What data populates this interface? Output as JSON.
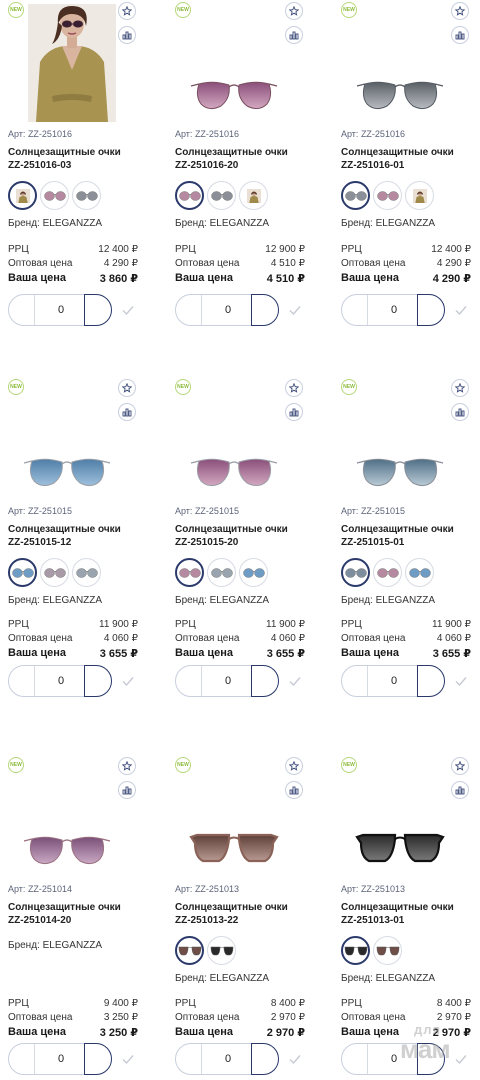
{
  "labels": {
    "new_badge": "NEW",
    "art_prefix": "Арт: ",
    "brand_prefix": "Бренд: ",
    "rrc": "РРЦ",
    "wholesale": "Оптовая цена",
    "your_price": "Ваша цена"
  },
  "watermark": {
    "line1": "для",
    "line2": "мам"
  },
  "products": [
    {
      "art": "ZZ-251016",
      "name_line1": "Солнцезащитные очки",
      "name_line2": "ZZ-251016-03",
      "brand": "ELEGANZZA",
      "rrc": "12 400 ₽",
      "wholesale": "4 290 ₽",
      "your_price": "3 860 ₽",
      "qty": "0",
      "image": "model-photo",
      "swatches": [
        {
          "icon": "model-swatch-icon",
          "active": true
        },
        {
          "icon": "glasses-swatch-icon",
          "lens": "#b58aa0",
          "active": false
        },
        {
          "icon": "glasses-swatch-icon",
          "lens": "#8a8f98",
          "active": false
        }
      ]
    },
    {
      "art": "ZZ-251016",
      "name_line1": "Солнцезащитные очки",
      "name_line2": "ZZ-251016-20",
      "brand": "ELEGANZZA",
      "rrc": "12 900 ₽",
      "wholesale": "4 510 ₽",
      "your_price": "4 510 ₽",
      "qty": "0",
      "image": "glasses",
      "lens": "#8a4f7a",
      "lens2": "#d3a8c1",
      "frame": "#7a5060",
      "swatches": [
        {
          "icon": "glasses-swatch-icon",
          "lens": "#b58aa0",
          "active": true
        },
        {
          "icon": "glasses-swatch-icon",
          "lens": "#8a8f98",
          "active": false
        },
        {
          "icon": "model-swatch-icon",
          "active": false
        }
      ]
    },
    {
      "art": "ZZ-251016",
      "name_line1": "Солнцезащитные очки",
      "name_line2": "ZZ-251016-01",
      "brand": "ELEGANZZA",
      "rrc": "12 400 ₽",
      "wholesale": "4 290 ₽",
      "your_price": "4 290 ₽",
      "qty": "0",
      "image": "glasses",
      "lens": "#5a5f66",
      "lens2": "#b8bcc2",
      "frame": "#555a62",
      "swatches": [
        {
          "icon": "glasses-swatch-icon",
          "lens": "#8a8f98",
          "active": true
        },
        {
          "icon": "glasses-swatch-icon",
          "lens": "#b58aa0",
          "active": false
        },
        {
          "icon": "model-swatch-icon",
          "active": false
        }
      ]
    },
    {
      "art": "ZZ-251015",
      "name_line1": "Солнцезащитные очки",
      "name_line2": "ZZ-251015-12",
      "brand": "ELEGANZZA",
      "rrc": "11 900 ₽",
      "wholesale": "4 060 ₽",
      "your_price": "3 655 ₽",
      "qty": "0",
      "image": "glasses",
      "lens": "#4f7ea8",
      "lens2": "#9ec0dc",
      "frame": "#9a9ea6",
      "swatches": [
        {
          "icon": "glasses-swatch-icon",
          "lens": "#6f9cc4",
          "active": true
        },
        {
          "icon": "glasses-swatch-icon",
          "lens": "#a89aa6",
          "active": false
        },
        {
          "icon": "glasses-swatch-icon",
          "lens": "#9aa4ae",
          "active": false
        }
      ]
    },
    {
      "art": "ZZ-251015",
      "name_line1": "Солнцезащитные очки",
      "name_line2": "ZZ-251015-20",
      "brand": "ELEGANZZA",
      "rrc": "11 900 ₽",
      "wholesale": "4 060 ₽",
      "your_price": "3 655 ₽",
      "qty": "0",
      "image": "glasses",
      "lens": "#8a4f7a",
      "lens2": "#d6b0c6",
      "frame": "#9a9ea6",
      "swatches": [
        {
          "icon": "glasses-swatch-icon",
          "lens": "#b58aa0",
          "active": true
        },
        {
          "icon": "glasses-swatch-icon",
          "lens": "#9aa4ae",
          "active": false
        },
        {
          "icon": "glasses-swatch-icon",
          "lens": "#6f9cc4",
          "active": false
        }
      ]
    },
    {
      "art": "ZZ-251015",
      "name_line1": "Солнцезащитные очки",
      "name_line2": "ZZ-251015-01",
      "brand": "ELEGANZZA",
      "rrc": "11 900 ₽",
      "wholesale": "4 060 ₽",
      "your_price": "3 655 ₽",
      "qty": "0",
      "image": "glasses",
      "lens": "#4f6f86",
      "lens2": "#b9cad6",
      "frame": "#8a8f98",
      "swatches": [
        {
          "icon": "glasses-swatch-icon",
          "lens": "#7d8f9e",
          "active": true
        },
        {
          "icon": "glasses-swatch-icon",
          "lens": "#b58aa0",
          "active": false
        },
        {
          "icon": "glasses-swatch-icon",
          "lens": "#6f9cc4",
          "active": false
        }
      ]
    },
    {
      "art": "ZZ-251014",
      "name_line1": "Солнцезащитные очки",
      "name_line2": "ZZ-251014-20",
      "brand": "ELEGANZZA",
      "rrc": "9 400 ₽",
      "wholesale": "3 250 ₽",
      "your_price": "3 250 ₽",
      "qty": "0",
      "image": "glasses",
      "lens": "#7a4f78",
      "lens2": "#c9a9c4",
      "frame": "#9a7080",
      "swatches": []
    },
    {
      "art": "ZZ-251013",
      "name_line1": "Солнцезащитные очки",
      "name_line2": "ZZ-251013-22",
      "brand": "ELEGANZZA",
      "rrc": "8 400 ₽",
      "wholesale": "2 970 ₽",
      "your_price": "2 970 ₽",
      "qty": "0",
      "image": "glasses-square",
      "lens": "#5e4038",
      "lens2": "#b89a92",
      "frame": "#8a6258",
      "swatches": [
        {
          "icon": "square-glasses-swatch-icon",
          "lens": "#6e4e46",
          "active": true
        },
        {
          "icon": "square-glasses-swatch-icon",
          "lens": "#2a2a2a",
          "active": false
        }
      ]
    },
    {
      "art": "ZZ-251013",
      "name_line1": "Солнцезащитные очки",
      "name_line2": "ZZ-251013-01",
      "brand": "ELEGANZZA",
      "rrc": "8 400 ₽",
      "wholesale": "2 970 ₽",
      "your_price": "2 970 ₽",
      "qty": "0",
      "image": "glasses-square",
      "lens": "#2a2a2a",
      "lens2": "#7a7a7a",
      "frame": "#111111",
      "swatches": [
        {
          "icon": "square-glasses-swatch-icon",
          "lens": "#2a2a2a",
          "active": true
        },
        {
          "icon": "square-glasses-swatch-icon",
          "lens": "#6e4e46",
          "active": false
        }
      ]
    }
  ]
}
